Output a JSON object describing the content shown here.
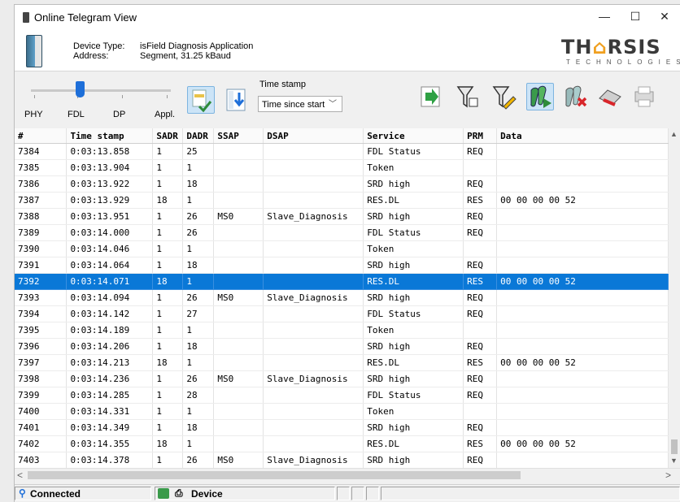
{
  "window": {
    "title": "Online Telegram View",
    "minimize": "—",
    "maximize": "☐",
    "close": "✕"
  },
  "header": {
    "device_type_label": "Device Type:",
    "device_type_value": "isField Diagnosis Application",
    "address_label": "Address:",
    "address_value": "Segment, 31.25 kBaud",
    "logo_main_1": "TH",
    "logo_roof": "⌂",
    "logo_main_2": "RSIS",
    "logo_sub": "TECHNOLOGIES"
  },
  "toolbar": {
    "layers": [
      "PHY",
      "FDL",
      "DP",
      "Appl."
    ],
    "layer_level": 0.35,
    "timestamp_label": "Time stamp",
    "timestamp_selected": "Time since start",
    "icons": [
      "filter-icon",
      "scroll-down-icon",
      "export-icon",
      "trigger-off-icon",
      "trigger-edit-icon",
      "start-recording-icon",
      "stop-recording-icon",
      "clear-icon",
      "print-icon"
    ]
  },
  "table": {
    "columns": [
      "#",
      "Time stamp",
      "SADR",
      "DADR",
      "SSAP",
      "DSAP",
      "Service",
      "PRM",
      "Data"
    ],
    "selected_index": 8,
    "rows": [
      [
        "7384",
        "0:03:13.858",
        "1",
        "25",
        "",
        "",
        "FDL Status",
        "REQ",
        ""
      ],
      [
        "7385",
        "0:03:13.904",
        "1",
        "1",
        "",
        "",
        "Token",
        "",
        ""
      ],
      [
        "7386",
        "0:03:13.922",
        "1",
        "18",
        "",
        "",
        "SRD high",
        "REQ",
        ""
      ],
      [
        "7387",
        "0:03:13.929",
        "18",
        "1",
        "",
        "",
        "RES.DL",
        "RES",
        "00 00 00 00 52"
      ],
      [
        "7388",
        "0:03:13.951",
        "1",
        "26",
        "MS0",
        "Slave_Diagnosis",
        "SRD high",
        "REQ",
        ""
      ],
      [
        "7389",
        "0:03:14.000",
        "1",
        "26",
        "",
        "",
        "FDL Status",
        "REQ",
        ""
      ],
      [
        "7390",
        "0:03:14.046",
        "1",
        "1",
        "",
        "",
        "Token",
        "",
        ""
      ],
      [
        "7391",
        "0:03:14.064",
        "1",
        "18",
        "",
        "",
        "SRD high",
        "REQ",
        ""
      ],
      [
        "7392",
        "0:03:14.071",
        "18",
        "1",
        "",
        "",
        "RES.DL",
        "RES",
        "00 00 00 00 52"
      ],
      [
        "7393",
        "0:03:14.094",
        "1",
        "26",
        "MS0",
        "Slave_Diagnosis",
        "SRD high",
        "REQ",
        ""
      ],
      [
        "7394",
        "0:03:14.142",
        "1",
        "27",
        "",
        "",
        "FDL Status",
        "REQ",
        ""
      ],
      [
        "7395",
        "0:03:14.189",
        "1",
        "1",
        "",
        "",
        "Token",
        "",
        ""
      ],
      [
        "7396",
        "0:03:14.206",
        "1",
        "18",
        "",
        "",
        "SRD high",
        "REQ",
        ""
      ],
      [
        "7397",
        "0:03:14.213",
        "18",
        "1",
        "",
        "",
        "RES.DL",
        "RES",
        "00 00 00 00 52"
      ],
      [
        "7398",
        "0:03:14.236",
        "1",
        "26",
        "MS0",
        "Slave_Diagnosis",
        "SRD high",
        "REQ",
        ""
      ],
      [
        "7399",
        "0:03:14.285",
        "1",
        "28",
        "",
        "",
        "FDL Status",
        "REQ",
        ""
      ],
      [
        "7400",
        "0:03:14.331",
        "1",
        "1",
        "",
        "",
        "Token",
        "",
        ""
      ],
      [
        "7401",
        "0:03:14.349",
        "1",
        "18",
        "",
        "",
        "SRD high",
        "REQ",
        ""
      ],
      [
        "7402",
        "0:03:14.355",
        "18",
        "1",
        "",
        "",
        "RES.DL",
        "RES",
        "00 00 00 00 52"
      ],
      [
        "7403",
        "0:03:14.378",
        "1",
        "26",
        "MS0",
        "Slave_Diagnosis",
        "SRD high",
        "REQ",
        ""
      ]
    ]
  },
  "scroll": {
    "up": "▲",
    "down": "▼",
    "left": "<",
    "right": ">"
  },
  "status": {
    "connection": "Connected",
    "device": "Device"
  },
  "colors": {
    "selection": "#0a78d7",
    "slider": "#1e6fd9",
    "logo_accent": "#f0a020"
  }
}
